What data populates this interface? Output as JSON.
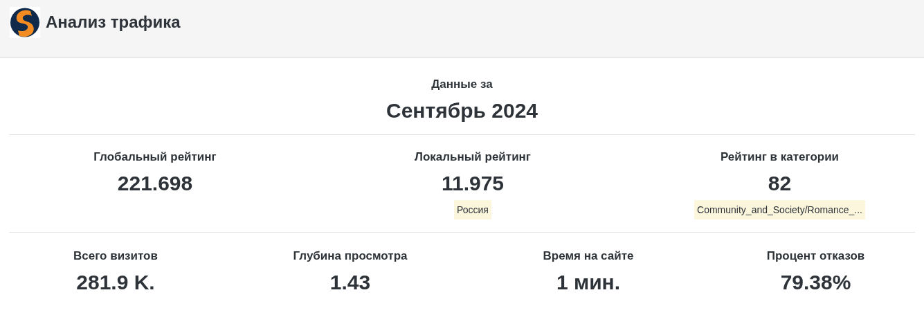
{
  "header": {
    "title": "Анализ трафика"
  },
  "period": {
    "label": "Данные за",
    "value": "Сентябрь 2024"
  },
  "ranks": [
    {
      "label": "Глобальный рейтинг",
      "value": "221.698"
    },
    {
      "label": "Локальный рейтинг",
      "value": "11.975",
      "tag": "Россия"
    },
    {
      "label": "Рейтинг в категории",
      "value": "82",
      "tag": "Community_and_Society/Romance_..."
    }
  ],
  "metrics": [
    {
      "label": "Всего визитов",
      "value": "281.9 K."
    },
    {
      "label": "Глубина просмотра",
      "value": "1.43"
    },
    {
      "label": "Время на сайте",
      "value": "1 мин."
    },
    {
      "label": "Процент отказов",
      "value": "79.38%"
    }
  ]
}
